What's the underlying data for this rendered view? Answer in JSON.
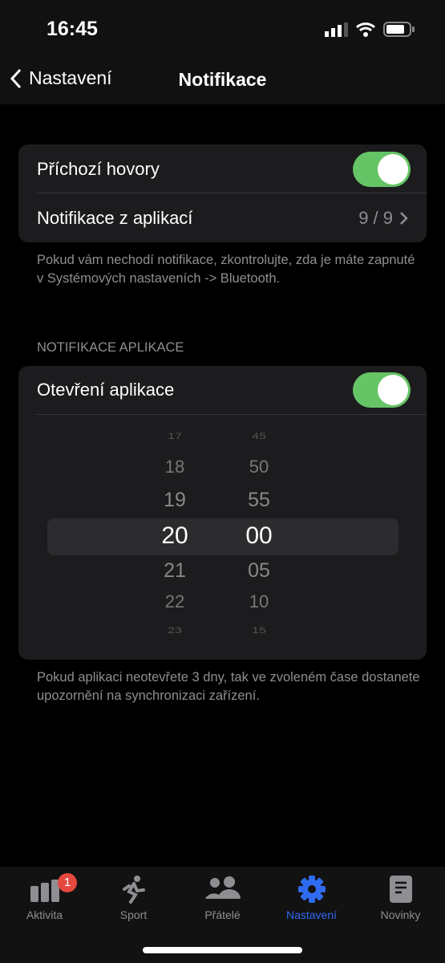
{
  "status": {
    "time": "16:45"
  },
  "nav": {
    "back_label": "Nastavení",
    "title": "Notifikace"
  },
  "card1": {
    "incoming_calls": "Příchozí hovory",
    "incoming_calls_on": true,
    "app_notifications": "Notifikace z aplikací",
    "app_notifications_count": "9 / 9"
  },
  "card1_footer": "Pokud vám nechodí notifikace, zkontrolujte, zda je máte zapnuté v Systémových nastaveních -> Bluetooth.",
  "section_header": "NOTIFIKACE APLIKACE",
  "card2": {
    "open_app": "Otevření aplikace",
    "open_app_on": true,
    "hours": [
      "17",
      "18",
      "19",
      "20",
      "21",
      "22",
      "23"
    ],
    "minutes": [
      "45",
      "50",
      "55",
      "00",
      "05",
      "10",
      "15"
    ],
    "selected": {
      "hour": "20",
      "minute": "00"
    }
  },
  "card2_footer": "Pokud aplikaci neotevřete 3 dny, tak ve zvoleném čase dostanete upozornění na synchronizaci zařízení.",
  "tabs": [
    {
      "label": "Aktivita",
      "icon": "bar-chart-icon",
      "badge": "1"
    },
    {
      "label": "Sport",
      "icon": "runner-icon"
    },
    {
      "label": "Přátelé",
      "icon": "people-icon"
    },
    {
      "label": "Nastavení",
      "icon": "gear-icon",
      "active": true
    },
    {
      "label": "Novinky",
      "icon": "news-icon"
    }
  ],
  "colors": {
    "accent": "#2f6bf0",
    "toggle_on": "#65c466",
    "badge": "#e5483f"
  }
}
